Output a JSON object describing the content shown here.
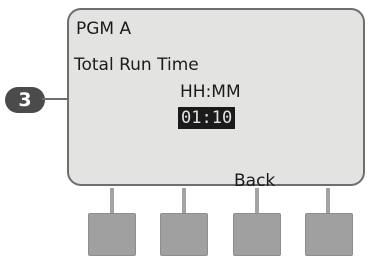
{
  "step": {
    "number": "3"
  },
  "display": {
    "program": "PGM A",
    "label": "Total Run Time",
    "format": "HH:MM",
    "value": "01:10"
  },
  "softkeys": [
    {
      "label": ""
    },
    {
      "label": ""
    },
    {
      "label": "Back"
    },
    {
      "label": ""
    }
  ]
}
